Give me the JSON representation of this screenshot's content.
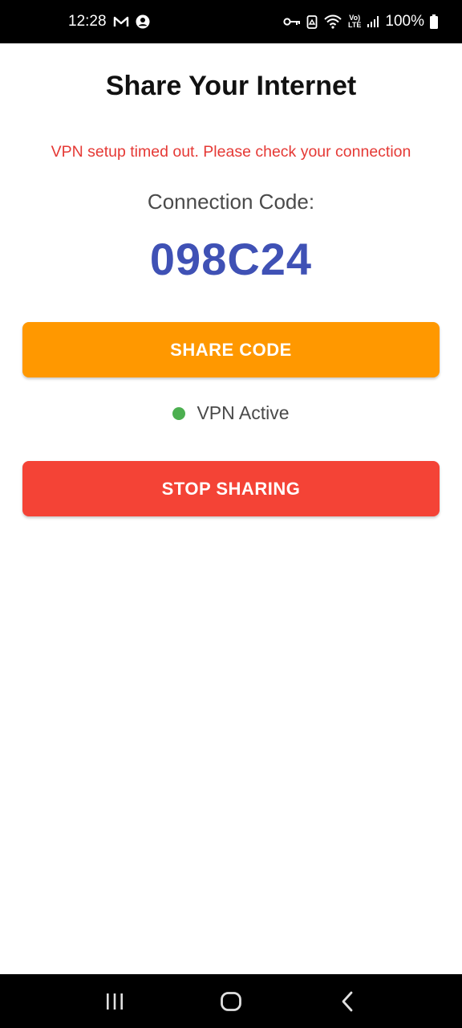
{
  "status_bar": {
    "time": "12:28",
    "network_type_top": "Vo)",
    "network_type_bottom": "LTE",
    "battery": "100%",
    "icons": [
      "gmail-icon",
      "account-icon",
      "vpn-key-icon",
      "recycle-icon",
      "wifi-icon",
      "volte-icon",
      "signal-icon",
      "battery-icon"
    ]
  },
  "screen": {
    "title": "Share Your Internet",
    "error_message": "VPN setup timed out. Please check your connection",
    "code_label": "Connection Code:",
    "code_value": "098C24",
    "share_button": "SHARE CODE",
    "vpn_status": "VPN Active",
    "stop_button": "STOP SHARING"
  },
  "colors": {
    "title": "#111111",
    "error": "#e53935",
    "code": "#3f51b5",
    "share_button": "#ff9800",
    "stop_button": "#f44336",
    "status_active": "#4caf50"
  },
  "nav_bar": {
    "icons": [
      "recents-icon",
      "home-icon",
      "back-icon"
    ]
  }
}
